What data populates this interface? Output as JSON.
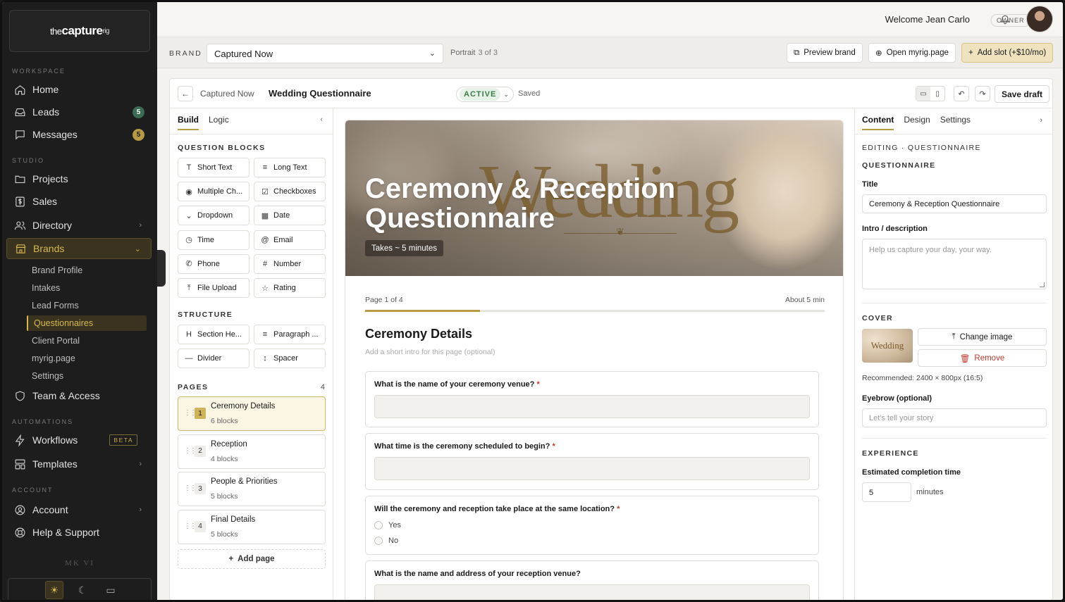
{
  "sidebar": {
    "logo": {
      "pre": "the",
      "main": "capture",
      "sup": "rig"
    },
    "sections": {
      "workspace": "WORKSPACE",
      "studio": "STUDIO",
      "automations": "AUTOMATIONS",
      "account": "ACCOUNT"
    },
    "workspace": [
      {
        "label": "Home",
        "icon": "home-icon"
      },
      {
        "label": "Leads",
        "icon": "inbox-icon",
        "badge": "5"
      },
      {
        "label": "Messages",
        "icon": "chat-icon",
        "badge": "5"
      }
    ],
    "studio": [
      {
        "label": "Projects",
        "icon": "folder-icon"
      },
      {
        "label": "Sales",
        "icon": "dollar-icon"
      },
      {
        "label": "Directory",
        "icon": "users-icon"
      },
      {
        "label": "Brands",
        "icon": "store-icon"
      }
    ],
    "brand_sub": [
      "Brand Profile",
      "Intakes",
      "Lead Forms",
      "Questionnaires",
      "Client Portal",
      "myrig.page",
      "Settings"
    ],
    "team": "Team & Access",
    "automations": [
      {
        "label": "Workflows",
        "icon": "bolt-icon",
        "tag": "BETA"
      },
      {
        "label": "Templates",
        "icon": "layout-icon"
      }
    ],
    "account": [
      {
        "label": "Account",
        "icon": "user-circle-icon"
      },
      {
        "label": "Help & Support",
        "icon": "help-icon"
      }
    ],
    "footer_mark": "MK VI"
  },
  "topbar": {
    "welcome": "Welcome Jean Carlo",
    "role": "OWNER"
  },
  "brandbar": {
    "label": "BRAND",
    "selected": "Captured Now",
    "portrait_label": "Portrait",
    "portrait_count": "3 of 3",
    "preview_btn": "Preview brand",
    "open_btn": "Open myrig.page",
    "add_slot_btn": "Add slot (+$10/mo)"
  },
  "editor": {
    "crumb_parent": "Captured Now",
    "crumb_title": "Wedding Questionnaire",
    "status": "ACTIVE",
    "saved": "Saved",
    "save_draft": "Save draft"
  },
  "builder": {
    "tabs": [
      "Build",
      "Logic"
    ],
    "question_blocks_title": "QUESTION BLOCKS",
    "question_blocks": [
      {
        "label": "Short Text",
        "glyph": "T"
      },
      {
        "label": "Long Text",
        "glyph": "≡"
      },
      {
        "label": "Multiple Ch...",
        "glyph": "◉"
      },
      {
        "label": "Checkboxes",
        "glyph": "☑"
      },
      {
        "label": "Dropdown",
        "glyph": "⌄"
      },
      {
        "label": "Date",
        "glyph": "▦"
      },
      {
        "label": "Time",
        "glyph": "◷"
      },
      {
        "label": "Email",
        "glyph": "@"
      },
      {
        "label": "Phone",
        "glyph": "✆"
      },
      {
        "label": "Number",
        "glyph": "#"
      },
      {
        "label": "File Upload",
        "glyph": "⤒"
      },
      {
        "label": "Rating",
        "glyph": "☆"
      }
    ],
    "structure_title": "STRUCTURE",
    "structure": [
      {
        "label": "Section He...",
        "glyph": "H"
      },
      {
        "label": "Paragraph ...",
        "glyph": "≡"
      },
      {
        "label": "Divider",
        "glyph": "—"
      },
      {
        "label": "Spacer",
        "glyph": "↕"
      }
    ],
    "pages_title": "PAGES",
    "pages_count": "4",
    "pages": [
      {
        "num": "1",
        "title": "Ceremony Details",
        "blocks": "6 blocks"
      },
      {
        "num": "2",
        "title": "Reception",
        "blocks": "4 blocks"
      },
      {
        "num": "3",
        "title": "People & Priorities",
        "blocks": "5 blocks"
      },
      {
        "num": "4",
        "title": "Final Details",
        "blocks": "5 blocks"
      }
    ],
    "add_page": "Add page"
  },
  "preview": {
    "hero_script": "Wedding",
    "hero_title": "Ceremony & Reception Questionnaire",
    "hero_chip": "Takes ~ 5 minutes",
    "page_label": "Page 1 of 4",
    "duration_label": "About 5 min",
    "progress": 0.25,
    "section_title": "Ceremony Details",
    "section_intro": "Add a short intro for this page (optional)",
    "questions": [
      {
        "label": "What is the name of your ceremony venue?",
        "required": "*"
      },
      {
        "label": "What time is the ceremony scheduled to begin?",
        "required": "*"
      },
      {
        "label": "Will the ceremony and reception take place at the same location?",
        "required": "*",
        "options": [
          "Yes",
          "No"
        ]
      },
      {
        "label": "What is the name and address of your reception venue?",
        "required": ""
      }
    ]
  },
  "inspector": {
    "tabs": [
      "Content",
      "Design",
      "Settings"
    ],
    "editing": "EDITING · QUESTIONNAIRE",
    "section": "QUESTIONNAIRE",
    "title_label": "Title",
    "title_value": "Ceremony & Reception Questionnaire",
    "intro_label": "Intro / description",
    "intro_placeholder": "Help us capture your day, your way.",
    "cover_title": "COVER",
    "cover_thumb_text": "Wedding",
    "change_image": "Change image",
    "remove": "Remove",
    "recommended": "Recommended: 2400 × 800px (16:5)",
    "eyebrow_label": "Eyebrow (optional)",
    "eyebrow_placeholder": "Let's tell your story",
    "experience_title": "EXPERIENCE",
    "completion_label": "Estimated completion time",
    "completion_value": "5",
    "minutes": "minutes"
  }
}
